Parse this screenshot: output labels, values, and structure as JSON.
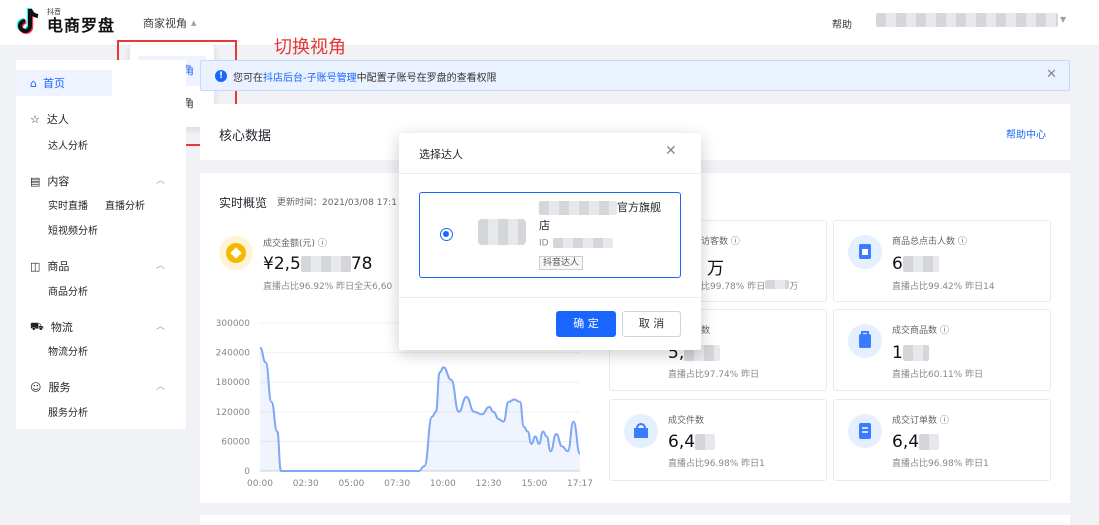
{
  "app": {
    "logo_small": "抖音",
    "logo_big": "电商罗盘",
    "view_switch": "商家视角",
    "help": "帮助"
  },
  "dropdown": {
    "items": [
      "商家视角",
      "达人视角"
    ]
  },
  "annotation": "切换视角",
  "sidebar": {
    "home": "首页",
    "groups": [
      {
        "label": "达人",
        "items": [
          "达人分析"
        ]
      },
      {
        "label": "内容",
        "items": [
          "实时直播",
          "直播分析",
          "短视频分析"
        ]
      },
      {
        "label": "商品",
        "items": [
          "商品分析"
        ]
      },
      {
        "label": "物流",
        "items": [
          "物流分析"
        ]
      },
      {
        "label": "服务",
        "items": [
          "服务分析"
        ]
      }
    ]
  },
  "notice": {
    "prefix": "您可在",
    "link": "抖店后台-子账号管理",
    "suffix": "中配置子账号在罗盘的查看权限"
  },
  "core": {
    "title": "核心数据",
    "help_center": "帮助中心"
  },
  "realtime": {
    "title": "实时概览",
    "updated": "更新时间：2021/03/08 17:1"
  },
  "kpis": {
    "gmv": {
      "label": "成交金额(元)",
      "value_prefix": "¥2,5",
      "value_suffix": "78",
      "sub": "直播占比96.92%  昨日全天6,60"
    },
    "visitors": {
      "label": "访客数",
      "value_suffix": "万",
      "sub_a": "比99.78%",
      "sub_b": "昨日",
      "sub_c": "万"
    },
    "clicks": {
      "label": "商品总点击人数",
      "value": "6",
      "sub": "直播占比99.42%  昨日14"
    },
    "buyers": {
      "label": "数",
      "value": "5,",
      "sub": "直播占比97.74%  昨日"
    },
    "products": {
      "label": "成交商品数",
      "value": "1",
      "sub": "直播占比60.11%  昨日"
    },
    "items": {
      "label": "成交件数",
      "value": "6,4",
      "sub": "直播占比96.98%  昨日1"
    },
    "orders": {
      "label": "成交订单数",
      "value": "6,4",
      "sub": "直播占比96.98%  昨日1"
    }
  },
  "chart_data": {
    "type": "line",
    "x_labels": [
      "00:00",
      "02:30",
      "05:00",
      "07:30",
      "10:00",
      "12:30",
      "15:00",
      "17:17"
    ],
    "y_ticks": [
      0,
      60000,
      120000,
      180000,
      240000,
      300000
    ],
    "ylim": [
      0,
      300000
    ],
    "x": [
      0,
      15,
      30,
      45,
      55,
      65,
      120,
      150,
      170,
      180,
      190,
      200,
      213,
      230,
      235,
      245,
      260,
      290,
      300,
      310,
      330,
      355,
      370,
      390,
      400,
      415,
      430,
      450,
      460,
      470,
      480,
      500,
      520,
      540,
      560,
      580,
      600,
      610,
      625,
      637,
      650,
      665,
      680,
      690,
      700,
      710,
      720,
      730,
      740,
      750,
      760,
      775,
      790,
      805,
      820,
      837
    ],
    "y": [
      250000,
      220000,
      140000,
      80000,
      0,
      0,
      0,
      0,
      0,
      0,
      0,
      0,
      0,
      0,
      0,
      0,
      0,
      0,
      0,
      0,
      0,
      0,
      0,
      0,
      0,
      0,
      10000,
      110000,
      120000,
      200000,
      210000,
      185000,
      120000,
      150000,
      120000,
      115000,
      130000,
      120000,
      105000,
      100000,
      140000,
      145000,
      140000,
      90000,
      80000,
      55000,
      70000,
      55000,
      80000,
      70000,
      40000,
      75000,
      50000,
      40000,
      100000,
      35000
    ],
    "xlim": [
      0,
      837
    ],
    "line_color": "#7da7f7"
  },
  "modal": {
    "title": "选择达人",
    "option_name_tail": "官方旗舰",
    "option_name_line2": "店",
    "option_id_label": "ID",
    "option_tag": "抖音达人",
    "ok": "确 定",
    "cancel": "取 消"
  }
}
